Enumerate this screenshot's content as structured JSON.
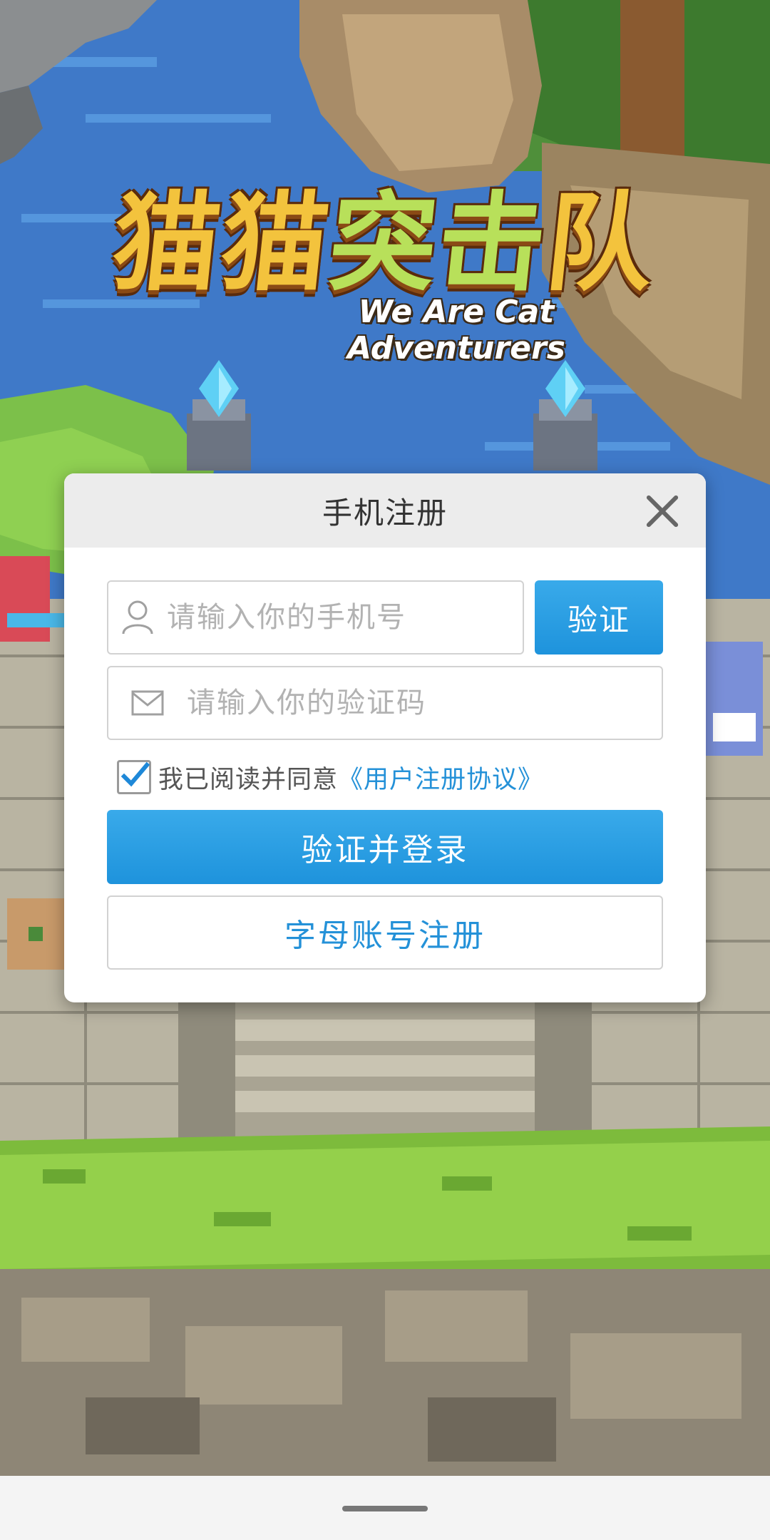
{
  "app": {
    "logo_title_part1": "猫猫",
    "logo_title_part2": "突击",
    "logo_title_part3": "队",
    "logo_subtitle": "We Are Cat Adventurers"
  },
  "dialog": {
    "title": "手机注册",
    "phone_placeholder": "请输入你的手机号",
    "phone_value": "",
    "verify_button": "验证",
    "code_placeholder": "请输入你的验证码",
    "code_value": "",
    "agree_checked": true,
    "agree_text": "我已阅读并同意",
    "agree_link": "《用户注册协议》",
    "login_button": "验证并登录",
    "alpha_register_button": "字母账号注册"
  },
  "icons": {
    "close": "close-icon",
    "user": "user-icon",
    "mail": "mail-icon",
    "check": "check-icon"
  },
  "colors": {
    "accent": "#1e93dc",
    "link": "#2491d8",
    "header_bg": "#ececec",
    "placeholder": "#b2b2b2"
  }
}
